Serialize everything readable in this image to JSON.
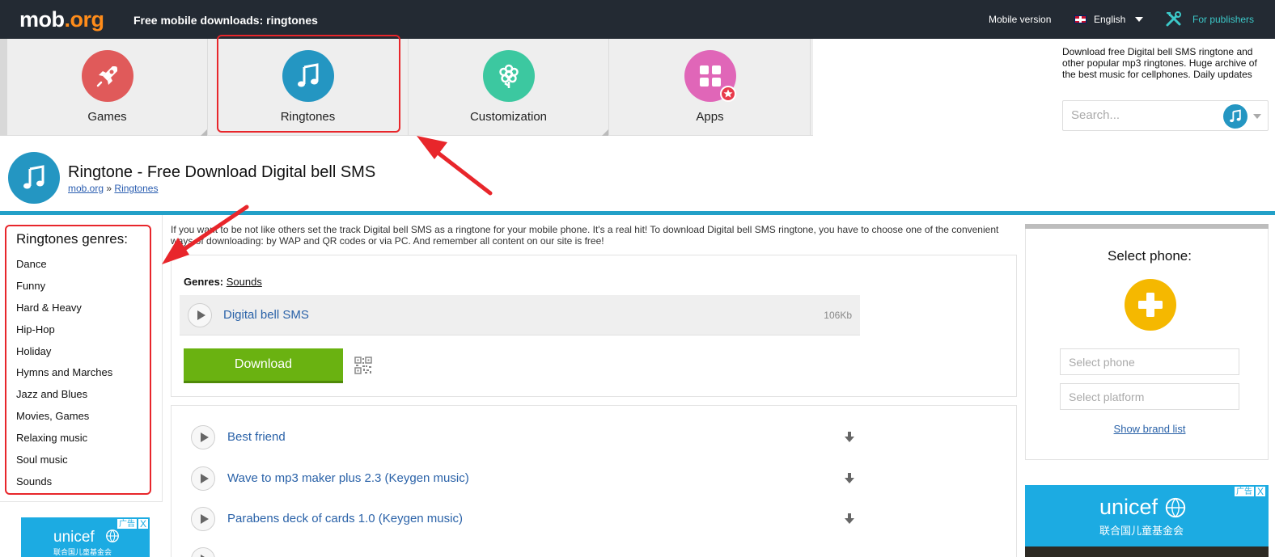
{
  "topbar": {
    "logo_main": "mob",
    "logo_tld": ".org",
    "tagline": "Free mobile downloads: ringtones",
    "mobile_version": "Mobile version",
    "language": "English",
    "publishers": "For publishers"
  },
  "categories": [
    {
      "label": "Games",
      "color": "#e05a5a",
      "icon": "rocket-icon"
    },
    {
      "label": "Ringtones",
      "color": "#2496c2",
      "icon": "music-note-icon"
    },
    {
      "label": "Customization",
      "color": "#3cc8a0",
      "icon": "flower-icon"
    },
    {
      "label": "Apps",
      "color": "#e066b8",
      "icon": "apps-grid-icon"
    }
  ],
  "site_description": "Download free Digital bell SMS ringtone and other popular mp3 ringtones. Huge archive of the best music for cellphones. Daily updates",
  "search": {
    "placeholder": "Search..."
  },
  "page": {
    "title": "Ringtone - Free Download Digital bell SMS",
    "breadcrumb_home": "mob.org",
    "breadcrumb_sep": "»",
    "breadcrumb_section": "Ringtones"
  },
  "sidebar": {
    "title": "Ringtones genres:",
    "genres": [
      "Dance",
      "Funny",
      "Hard & Heavy",
      "Hip-Hop",
      "Holiday",
      "Hymns and Marches",
      "Jazz and Blues",
      "Movies, Games",
      "Relaxing music",
      "Soul music",
      "Sounds"
    ]
  },
  "main": {
    "intro": "If you want to be not like others set the track Digital bell SMS as a ringtone for your mobile phone. It's a real hit! To download Digital bell SMS ringtone, you have to choose one of the convenient ways of downloading: by WAP and QR codes or via PC. And remember all content on our site is free!",
    "genres_label": "Genres:",
    "genres_value": "Sounds",
    "track_name": "Digital bell SMS",
    "track_size": "106Kb",
    "download_label": "Download",
    "related": [
      "Best friend",
      "Wave to mp3 maker plus 2.3 (Keygen music)",
      "Parabens deck of cards 1.0 (Keygen music)"
    ]
  },
  "right_panel": {
    "title": "Select phone:",
    "phone_placeholder": "Select phone",
    "platform_placeholder": "Select platform",
    "brand_list": "Show brand list"
  },
  "ads": {
    "brand": "unicef",
    "cn_text": "联合国儿童基金会",
    "tag": "广告",
    "close": "X"
  }
}
